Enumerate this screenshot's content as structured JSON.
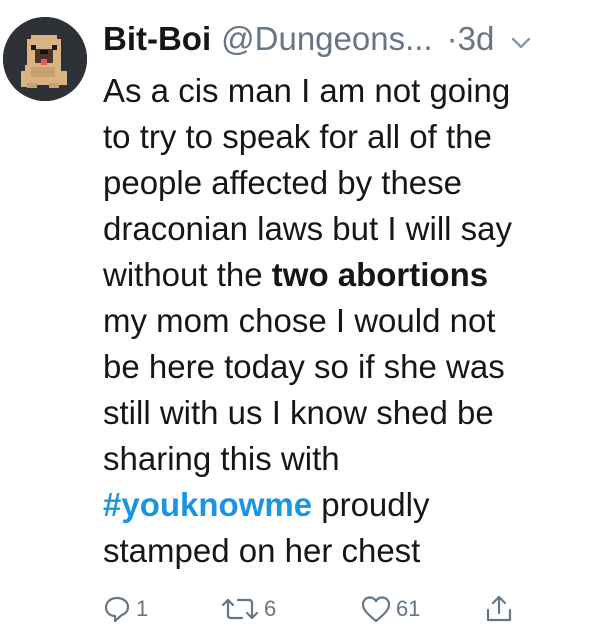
{
  "tweet": {
    "display_name": "Bit-Boi",
    "handle": "@Dungeons...",
    "separator_time": "·3d",
    "body": {
      "line1": "As a cis man I am not going",
      "line2": "to try to speak for all of the",
      "line3": "people affected by these",
      "line4": "draconian laws but I will say",
      "line5_pre": "without the ",
      "line5_bold": "two abortions",
      "line6": "my mom chose I would not",
      "line7": "be here today so if she was",
      "line8": "still with us I know shed be",
      "line9": "sharing this with",
      "line10_hashtag": "#youknowme",
      "line10_post": " proudly",
      "line11": "stamped on her chest"
    },
    "actions": {
      "reply_count": "1",
      "retweet_count": "6",
      "like_count": "61"
    },
    "icons": {
      "avatar": "pixel-pug-avatar",
      "menu": "chevron-down-icon",
      "reply": "reply-icon",
      "retweet": "retweet-icon",
      "like": "heart-icon",
      "share": "share-icon"
    },
    "colors": {
      "text": "#14171a",
      "muted": "#657786",
      "link": "#1b95e0",
      "avatar_bg": "#2e3136"
    }
  }
}
